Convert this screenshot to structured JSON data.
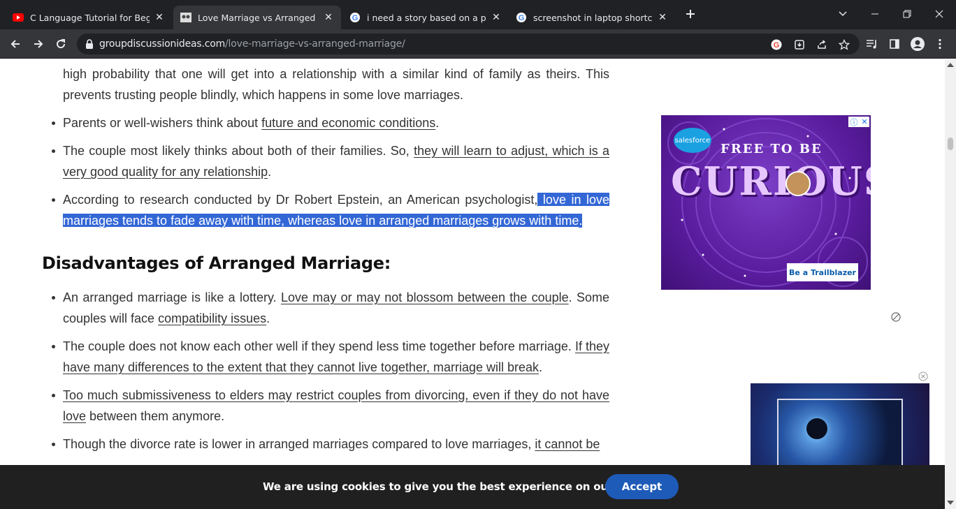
{
  "browser": {
    "tabs": [
      {
        "title": "C Language Tutorial for Beginne",
        "icon": "youtube-icon"
      },
      {
        "title": "Love Marriage vs Arranged Marr",
        "icon": "site-favicon-icon",
        "active": true
      },
      {
        "title": "i need a story based on a paper",
        "icon": "google-icon"
      },
      {
        "title": "screenshot in laptop shortcut - G",
        "icon": "google-icon"
      }
    ],
    "url_domain": "groupdiscussionideas.com",
    "url_path": "/love-marriage-vs-arranged-marriage/"
  },
  "article": {
    "top_para": "high probability that one will get into a relationship with a similar kind of family as theirs. This prevents trusting people blindly, which happens in some love marriages.",
    "adv_items": [
      {
        "pre": "Parents or well-wishers think about ",
        "link": "future and economic conditions",
        "post": "."
      },
      {
        "pre": "The couple most likely thinks about both of their families. So, ",
        "link": "they will learn to adjust, which is a very good quality for any relationship",
        "post": "."
      },
      {
        "pre": "According to research conducted by Dr Robert Epstein, an American psychologist,",
        "link": " love in love marriages tends to fade away with time, whereas love in arranged marriages grows with time",
        "post": "."
      }
    ],
    "heading": "Disadvantages of Arranged Marriage:",
    "dis_items": [
      {
        "pre": "An arranged marriage is like a lottery. ",
        "link": "Love may or may not blossom between the couple",
        "mid": ". Some couples will face ",
        "link2": "compatibility issues",
        "post": "."
      },
      {
        "pre": "The couple does not know each other well if they spend less time together before marriage. ",
        "link": "If they have many differences to the extent that they cannot live together, marriage will break",
        "post": "."
      },
      {
        "pre": "",
        "link": "Too much submissiveness to elders may restrict couples from divorcing, even if they do not have love",
        "post": " between them anymore."
      },
      {
        "pre": "Though the divorce rate is lower in arranged marriages compared to love marriages, ",
        "link": "it cannot be",
        "post": ""
      }
    ]
  },
  "ad": {
    "brand": "salesforce",
    "tagline": "FREE TO BE",
    "headline": "CURIOUS",
    "cta": "Be a Trailblazer"
  },
  "cookie": {
    "message": "We are using cookies to give you the best experience on our website.",
    "accept": "Accept"
  },
  "colors": {
    "highlight": "#3367d6",
    "accept": "#1e5bb8",
    "ad_bg": "#5a1c9e"
  }
}
